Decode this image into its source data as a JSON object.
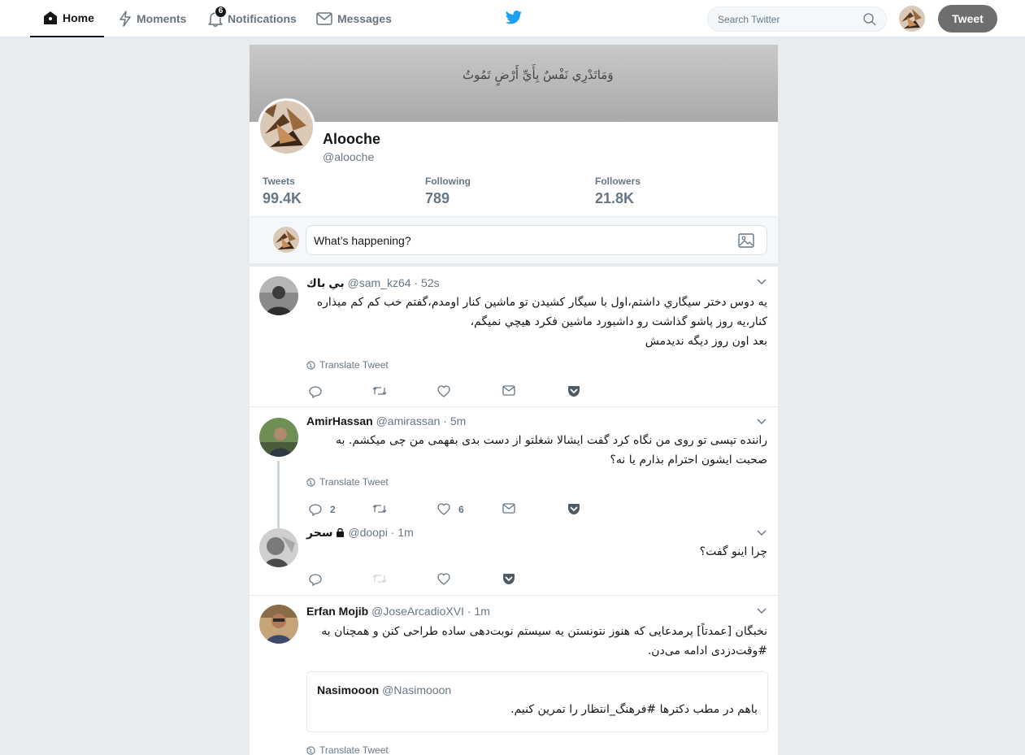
{
  "nav": {
    "home": "Home",
    "moments": "Moments",
    "notifications": "Notifications",
    "notifications_count": "6",
    "messages": "Messages"
  },
  "search": {
    "placeholder": "Search Twitter"
  },
  "tweet_button": "Tweet",
  "profile": {
    "banner_text": "وَمَاتَدْرِي نَفْسٌ بِأَيِّ أَرْضٍ تَمُوتُ",
    "name": "Alooche",
    "handle": "@alooche",
    "stats": [
      {
        "label": "Tweets",
        "value": "99.4K"
      },
      {
        "label": "Following",
        "value": "789"
      },
      {
        "label": "Followers",
        "value": "21.8K"
      }
    ]
  },
  "composer": {
    "placeholder": "What’s happening?"
  },
  "translate_label": "Translate Tweet",
  "tweets": [
    {
      "name": "بي باك",
      "handle": "@sam_kz64",
      "time": "52s",
      "lines": [
        "یه دوس دختر سیگاري داشتم،اول با سیگار کشیدن تو ماشین کنار اومدم،گفتم خب کم کم میذاره",
        "کنار،یه روز پاشو گذاشت رو داشبورد ماشین فکرد هیچي نمیگم،",
        "بعد اون روز دیگه ندیدمش"
      ]
    },
    {
      "name": "AmirHassan",
      "handle": "@amirassan",
      "time": "5m",
      "lines": [
        "راننده تپسی تو روی من نگاه کرد گفت ایشالا شغلتو از دست بدی بفهمی من چی میکشم. به",
        "صحبت ایشون احترام بذارم یا نه؟"
      ],
      "reply_count": "2",
      "like_count": "6"
    },
    {
      "name": "سحر",
      "handle": "@doopi",
      "time": "1m",
      "lines": [
        "چرا اینو گفت؟"
      ]
    },
    {
      "name": "Erfan Mojib",
      "handle": "@JoseArcadioXVI",
      "time": "1m",
      "lines": [
        "نخبگان [عمدتاً] پرمدعایی که هنوز نتونستن یه سیستم نوبت‌دهی ساده طراحی کنن و همچنان به",
        "#وقت‌دزدی ادامه می‌دن."
      ],
      "quote": {
        "name": "Nasimooon",
        "handle": "@Nasimooon",
        "text": "باهم در مطب دکترها #فرهنگ_انتظار را تمرین کنیم."
      }
    }
  ]
}
